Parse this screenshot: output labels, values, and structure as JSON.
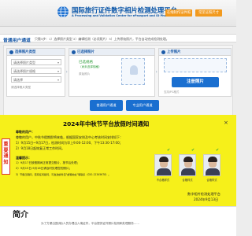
{
  "header": {
    "title": "国际旅行证件数字相片检测处理平台",
    "subtitle": "A Processing and Validation Center for ePassport and ID Photos",
    "button_left": "在线制作证件照",
    "button_right": "常见证照尺寸"
  },
  "notice_bar": {
    "title": "普通用户通道",
    "text": "只需3步：1）选择照片类型 2）编辑检测（必须照片）3）上传原始照片，平台自动完成检测处理。"
  },
  "steps": {
    "select": {
      "title": "选择照片类型",
      "options": [
        "请选择照片类型",
        "请选择照片规格",
        "请选择"
      ],
      "hint": "请选择照片类型"
    },
    "preview": {
      "title": "已选择照片",
      "selected": "已选规格",
      "selected_detail": "（尚未选择规格）",
      "original_label": "原始照片"
    },
    "upload": {
      "title": "上传照片",
      "button": "注册照片",
      "hint": "支持JPG格式"
    }
  },
  "actions": {
    "left": "普通用户通道",
    "right": "专业用户通道"
  },
  "overlay": {
    "side_tag": "重要通知",
    "title": "2024年中秋节平台放假时间通知",
    "lines": [
      {
        "text": "尊敬的用户：",
        "bold": true
      },
      {
        "text": "尊敬的用户，中秋节假期即将来临，根据国家安排及中心考核时间安排如下：",
        "bold": false
      },
      {
        "text": "1）9月15日~9月17日，检测时间为早上9:00-12:00、下午13:30-17:00；",
        "bold": false
      },
      {
        "text": "2）9月18日起恢复正常工作时间。",
        "bold": false
      },
      {
        "text": "温馨提示：",
        "bold": true
      },
      {
        "text": "1）9月17日放假期间正常提交照片，按节后处理；",
        "bold": false
      },
      {
        "text": "2）9月15日-9月16日请及时处理您的照片；",
        "bold": false
      },
      {
        "text": "3）节假日期间，若有任何疑问，可发送邮件至\"邮箱地址\"等联系（020-12345678）。",
        "bold": false
      }
    ],
    "signature": "数字相片检测处理平台",
    "date": "2024年9月13日"
  },
  "samples": [
    {
      "caption": "不合格样式"
    },
    {
      "caption": "合格样式"
    },
    {
      "caption": "合格样式"
    }
  ],
  "intro": {
    "title": "简介",
    "text": "为了方便出国(境)人员办理出入境证件，平台提供证件照片检测和处理服务……"
  },
  "colors": {
    "brand_blue": "#0b56a8",
    "button_blue": "#1a6fd0",
    "orange": "#f29a1e",
    "notice_yellow": "#f6f01a"
  }
}
